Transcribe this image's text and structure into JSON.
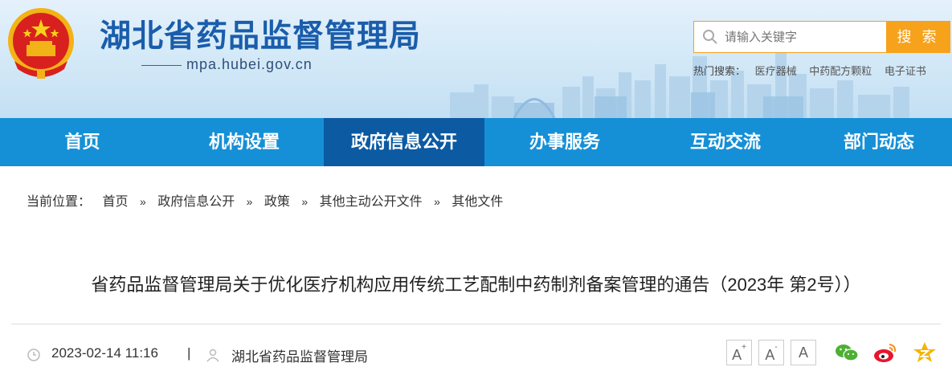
{
  "header": {
    "site_title": "湖北省药品监督管理局",
    "domain": "mpa.hubei.gov.cn",
    "logo_icon": "national-emblem-icon",
    "search": {
      "placeholder": "请输入关键字",
      "button_label": "搜 索"
    },
    "hot_search": {
      "label": "热门搜索：",
      "links": [
        "医疗器械",
        "中药配方颗粒",
        "电子证书"
      ]
    }
  },
  "nav": {
    "items": [
      {
        "label": "首页"
      },
      {
        "label": "机构设置"
      },
      {
        "label": "政府信息公开"
      },
      {
        "label": "办事服务"
      },
      {
        "label": "互动交流"
      },
      {
        "label": "部门动态"
      }
    ],
    "active_index": 2
  },
  "breadcrumb": {
    "prefix": "当前位置：",
    "items": [
      "首页",
      "政府信息公开",
      "政策",
      "其他主动公开文件",
      "其他文件"
    ]
  },
  "article": {
    "title": "省药品监督管理局关于优化医疗机构应用传统工艺配制中药制剂备案管理的通告（2023年 第2号））",
    "date": "2023-02-14 11:16",
    "separator": "|",
    "source": "湖北省药品监督管理局"
  },
  "tools": {
    "font_increase": "A",
    "font_decrease": "A",
    "font_reset": "A",
    "share_icons": [
      "wechat-icon",
      "weibo-icon",
      "qzone-icon"
    ]
  },
  "colors": {
    "title_blue": "#1a5dab",
    "nav_blue": "#1590d6",
    "nav_active": "#0c5aa2",
    "search_orange": "#f7a21b",
    "wechat_green": "#4cb034",
    "weibo_red": "#e6162d",
    "qzone_yellow": "#f5b400"
  }
}
